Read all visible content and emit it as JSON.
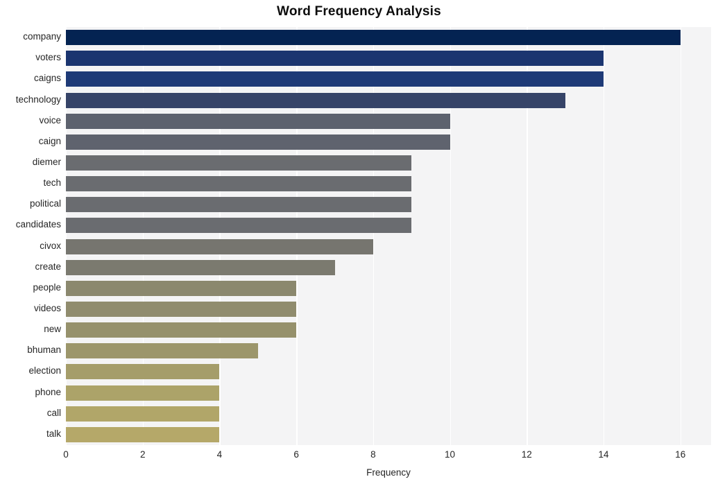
{
  "chart_data": {
    "type": "bar",
    "orientation": "horizontal",
    "title": "Word Frequency Analysis",
    "xlabel": "Frequency",
    "ylabel": "",
    "xlim": [
      0,
      16.8
    ],
    "xticks": [
      0,
      2,
      4,
      6,
      8,
      10,
      12,
      14,
      16
    ],
    "xtick_labels": [
      "0",
      "2",
      "4",
      "6",
      "8",
      "10",
      "12",
      "14",
      "16"
    ],
    "grid": "vertical-white-on-gray",
    "legend": "none",
    "categories": [
      "company",
      "voters",
      "caigns",
      "technology",
      "voice",
      "caign",
      "diemer",
      "tech",
      "political",
      "candidates",
      "civox",
      "create",
      "people",
      "videos",
      "new",
      "bhuman",
      "election",
      "phone",
      "call",
      "talk"
    ],
    "values": [
      16,
      14,
      14,
      13,
      10,
      10,
      9,
      9,
      9,
      9,
      8,
      7,
      6,
      6,
      6,
      5,
      4,
      4,
      4,
      4
    ],
    "bar_colors": [
      "#042352",
      "#1b3570",
      "#1e3a77",
      "#364468",
      "#5d626e",
      "#5f636e",
      "#6a6c70",
      "#6a6c70",
      "#6a6c70",
      "#6a6c70",
      "#76756f",
      "#7b7a6f",
      "#8b886e",
      "#908c6e",
      "#96916c",
      "#9c966b",
      "#a59d6a",
      "#aca369",
      "#b1a669",
      "#b5a869"
    ],
    "plot_background": "#f4f4f5",
    "figure_background": "#ffffff",
    "gridline_color": "#ffffff",
    "text_color": "#262626"
  }
}
